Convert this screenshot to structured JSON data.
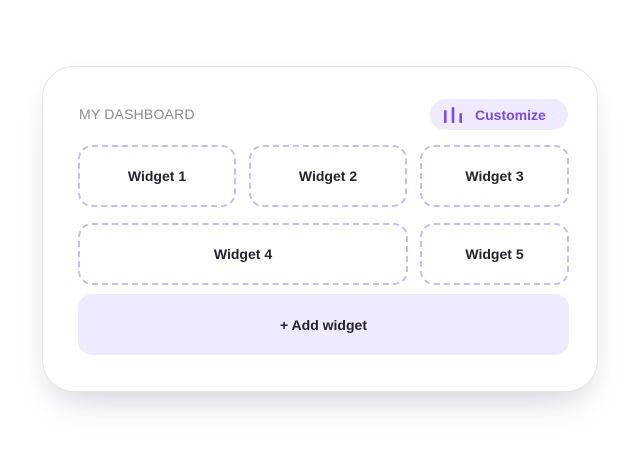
{
  "dashboard": {
    "title": "MY DASHBOARD",
    "customize_label": "Customize",
    "customize_icon": "bar-chart-icon",
    "add_label": "+ Add widget"
  },
  "widgets": [
    {
      "label": "Widget 1"
    },
    {
      "label": "Widget 2"
    },
    {
      "label": "Widget 3"
    },
    {
      "label": "Widget 4"
    },
    {
      "label": "Widget 5"
    }
  ],
  "colors": {
    "accent": "#7b4ae2",
    "accent_bg": "#efeafd",
    "dashed_border": "#c8bdf0",
    "title_text": "#8a8a98",
    "body_text": "#222230"
  }
}
